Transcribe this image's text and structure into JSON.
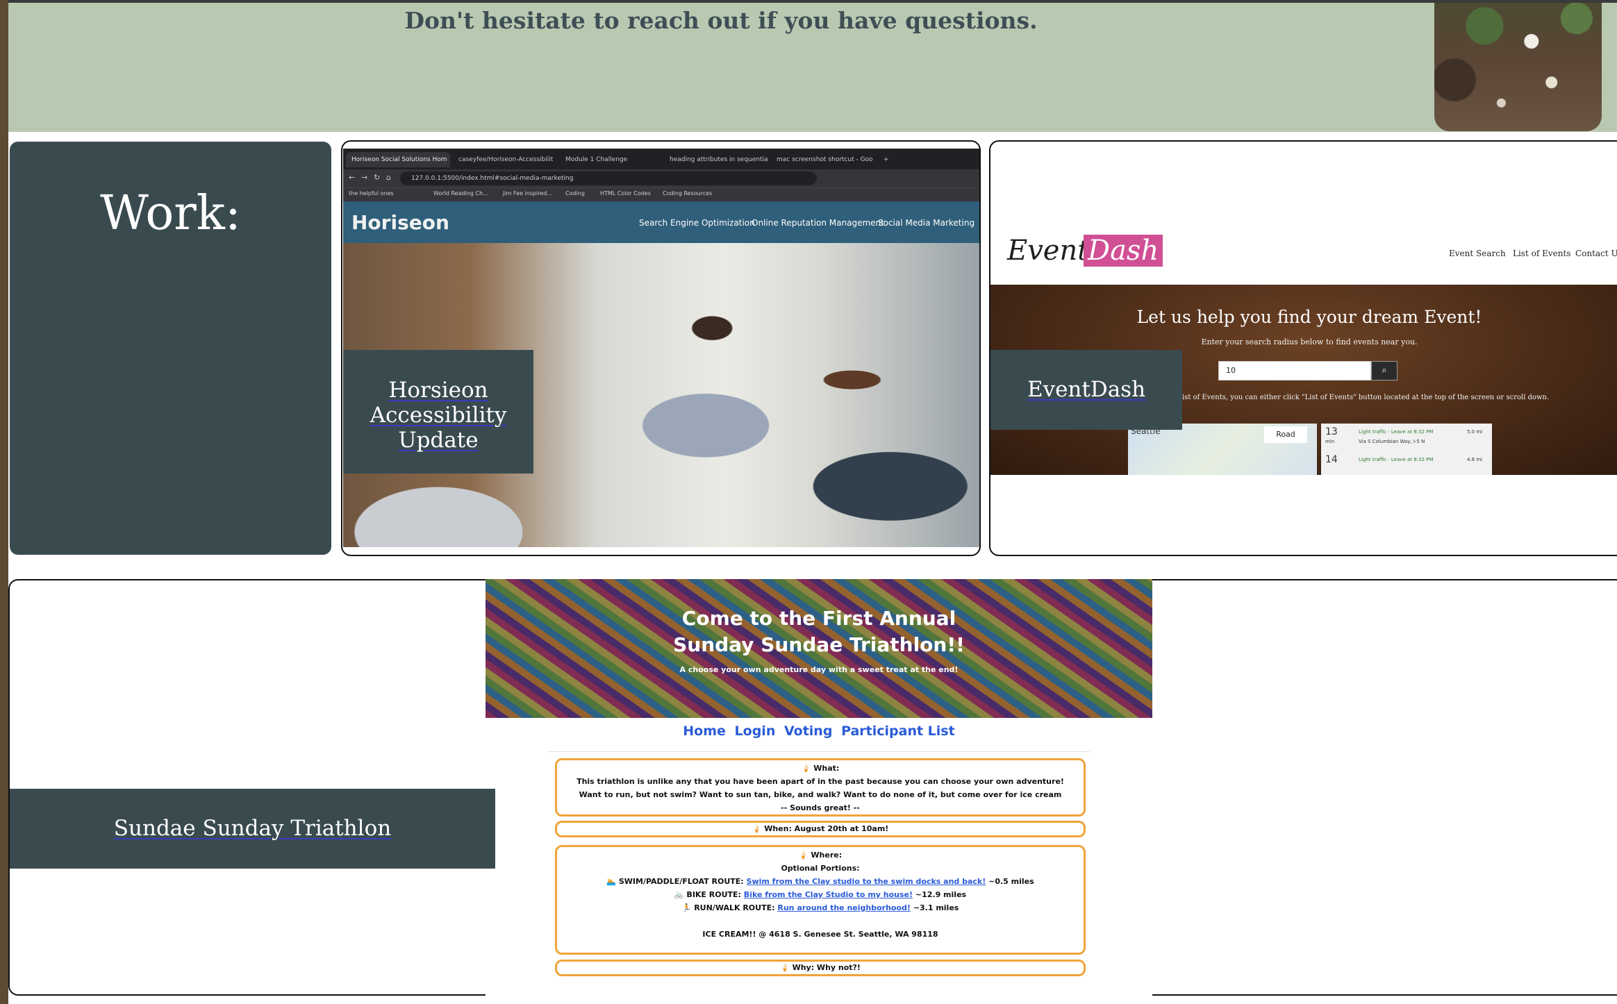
{
  "contact": {
    "message": "Don't hesitate to reach out if you have questions."
  },
  "work": {
    "heading": "Work:"
  },
  "projects": [
    {
      "title": "Horsieon Accessibility Update"
    },
    {
      "title": "EventDash"
    },
    {
      "title": "Sundae Sunday Triathlon"
    }
  ],
  "horiseon_shot": {
    "tabs": [
      "Horiseon Social Solutions Hom",
      "caseyfee/Horiseon-Accessibilit",
      "Module 1 Challenge",
      "heading attributes in sequentia",
      "mac screenshot shortcut - Goo"
    ],
    "url": "127.0.0.1:5500/index.html#social-media-marketing",
    "bookmarks": [
      "the helpful ones",
      "World Reading Ch...",
      "Jim Fee inspired...",
      "Coding",
      "HTML Color Codes",
      "Coding Resources"
    ],
    "logo": "Horiseon",
    "nav": [
      "Search Engine Optimization",
      "Online Reputation Management",
      "Social Media Marketing"
    ]
  },
  "eventdash_shot": {
    "logo_part1": "Event",
    "logo_part2": "Dash",
    "nav": [
      "Event Search",
      "List of Events",
      "Contact Us"
    ],
    "headline": "Let us help you find your dream Event!",
    "subheadline": "Enter your search radius below to find events near you.",
    "search_value": "10",
    "note": "ist of Events, you can either click \"List of Events\" button located at the top of the screen or scroll down.",
    "map_label": "Seattle",
    "map_type": "Road",
    "results": [
      {
        "minutes": "13",
        "unit": "min",
        "traffic": "Light traffic · Leave at 8:32 PM",
        "distance": "5.0 mi",
        "route": "Via S Columbian Way, I-5 N"
      },
      {
        "minutes": "14",
        "traffic": "Light traffic · Leave at 8:32 PM",
        "distance": "4.8 mi"
      }
    ]
  },
  "sundae_shot": {
    "title": "Come to the First Annual Sunday Sundae Triathlon!!",
    "tagline": "A choose your own adventure day with a sweet treat at the end!",
    "nav": [
      "Home",
      "Login",
      "Voting",
      "Participant List"
    ],
    "what": {
      "heading": "🍦 What:",
      "line1": "This triathlon is unlike any that you have been apart of in the past because you can choose your own adventure!",
      "line2": "Want to run, but not swim? Want to sun tan, bike, and walk? Want to do none of it, but come over for ice cream",
      "line3": "-- Sounds great! --"
    },
    "when": "🍦 When: August 20th at 10am!",
    "where": {
      "heading": "🍦 Where:",
      "optional": "Optional Portions:",
      "swim_label": "🏊 SWIM/PADDLE/FLOAT ROUTE:",
      "swim_link": "Swim from the Clay studio to the swim docks and back!",
      "swim_distance": "~0.5 miles",
      "bike_label": "🚲 BIKE ROUTE:",
      "bike_link": "Bike from the Clay Studio to my house!",
      "bike_distance": "~12.9 miles",
      "run_label": "🏃 RUN/WALK ROUTE:",
      "run_link": "Run around the neighborhood!",
      "run_distance": "~3.1 miles",
      "icecream": "ICE CREAM!! @ 4618 S. Genesee St. Seattle, WA 98118"
    },
    "why": "🍦 Why: Why not?!"
  }
}
